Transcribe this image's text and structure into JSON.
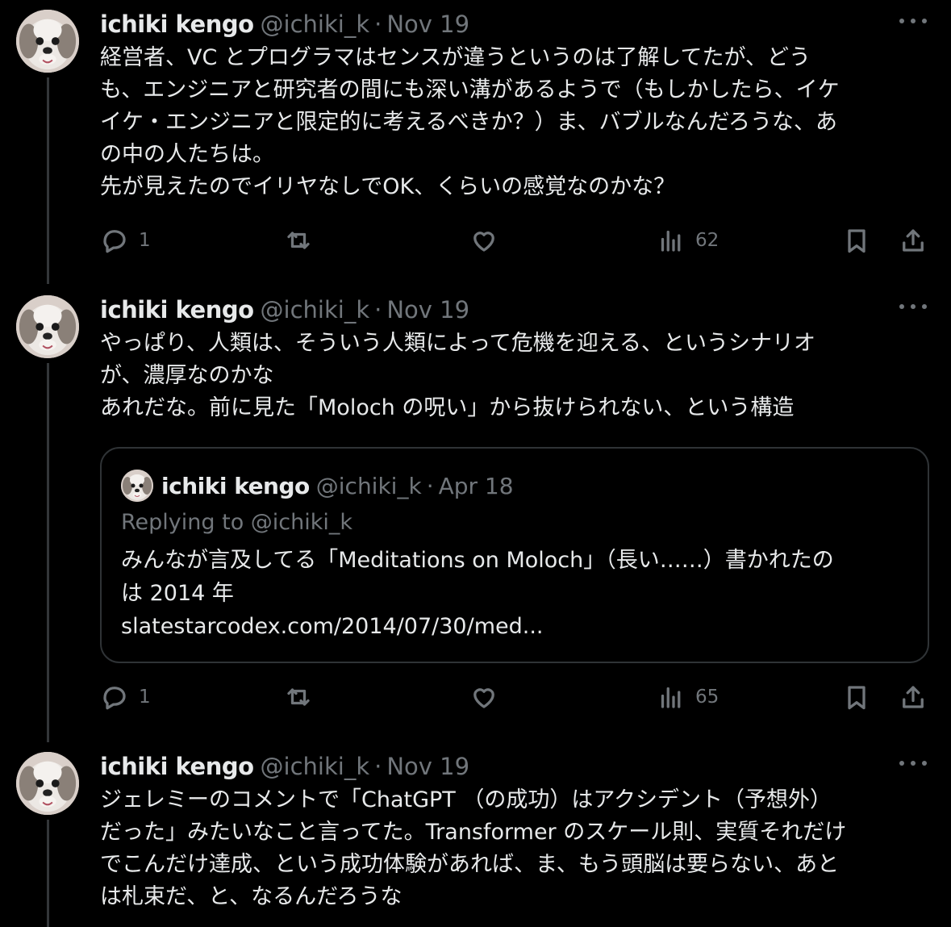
{
  "tweets": [
    {
      "author": {
        "name": "ichiki kengo",
        "handle": "@ichiki_k",
        "date": "Nov 19",
        "separator": "·"
      },
      "text": "経営者、VC とプログラマはセンスが違うというのは了解してたが、どう\nも、エンジニアと研究者の間にも深い溝があるようで（もしかしたら、イケ\nイケ・エンジニアと限定的に考えるべきか？）ま、バブルなんだろうな、あ\nの中の人たちは。\n先が見えたのでイリヤなしでOK、くらいの感覚なのかな？",
      "actions": {
        "reply_count": "1",
        "repost_count": "",
        "like_count": "",
        "view_count": "62"
      }
    },
    {
      "author": {
        "name": "ichiki kengo",
        "handle": "@ichiki_k",
        "date": "Nov 19",
        "separator": "·"
      },
      "text": "やっぱり、人類は、そういう人類によって危機を迎える、というシナリオ\nが、濃厚なのかな\nあれだな。前に見た「Moloch の呪い」から抜けられない、という構造",
      "quote": {
        "author": {
          "name": "ichiki kengo",
          "handle": "@ichiki_k",
          "date": "Apr 18",
          "separator": "·"
        },
        "replying_to": "Replying to @ichiki_k",
        "text": "みんなが言及してる「Meditations on Moloch」（長い……）書かれたの\nは 2014 年\nslatestarcodex.com/2014/07/30/med..."
      },
      "actions": {
        "reply_count": "1",
        "repost_count": "",
        "like_count": "",
        "view_count": "65"
      }
    },
    {
      "author": {
        "name": "ichiki kengo",
        "handle": "@ichiki_k",
        "date": "Nov 19",
        "separator": "·"
      },
      "text": "ジェレミーのコメントで「ChatGPT （の成功）はアクシデント（予想外）\nだった」みたいなこと言ってた。Transformer のスケール則、実質それだけ\nでこんだけ達成、という成功体験があれば、ま、もう頭脳は要らない、あと\nは札束だ、と、なるんだろうな"
    }
  ],
  "icons": {
    "avatar": "shih-tzu-dog-avatar",
    "reply": "speech-bubble-icon",
    "repost": "repost-arrows-icon",
    "like": "heart-icon",
    "views": "bar-chart-icon",
    "bookmark": "bookmark-icon",
    "share": "share-upload-icon",
    "more": "more-dots-icon"
  },
  "colors": {
    "background": "#000000",
    "text": "#e7e9ea",
    "secondary": "#71767b",
    "border": "#2f3336"
  }
}
